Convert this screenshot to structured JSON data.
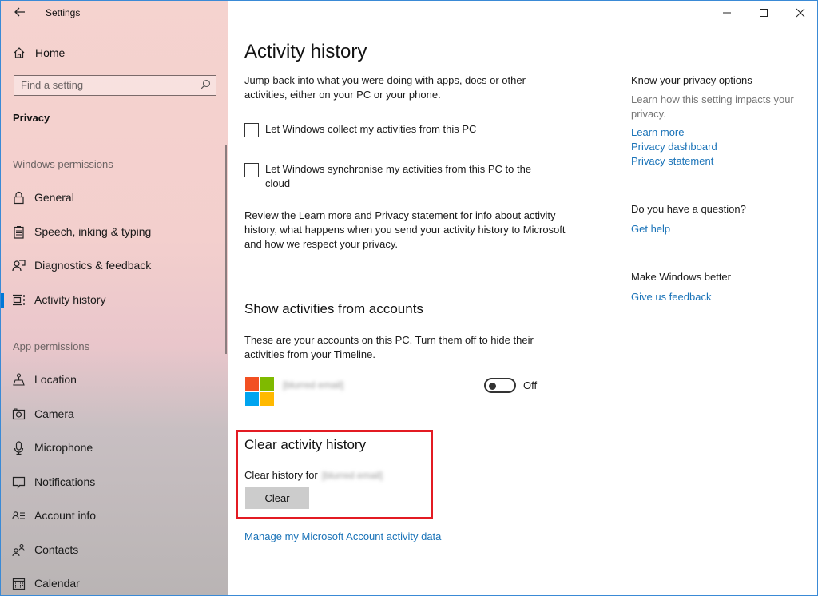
{
  "window": {
    "title": "Settings",
    "controls": {
      "minimize": "minimize",
      "maximize": "maximize",
      "close": "close"
    }
  },
  "sidebar": {
    "home_label": "Home",
    "search_placeholder": "Find a setting",
    "category": "Privacy",
    "sections": [
      {
        "header": "Windows permissions",
        "items": [
          {
            "label": "General",
            "icon": "lock-icon"
          },
          {
            "label": "Speech, inking & typing",
            "icon": "clipboard-icon"
          },
          {
            "label": "Diagnostics & feedback",
            "icon": "diagnostics-icon"
          },
          {
            "label": "Activity history",
            "icon": "timeline-icon",
            "active": true
          }
        ]
      },
      {
        "header": "App permissions",
        "items": [
          {
            "label": "Location",
            "icon": "location-icon"
          },
          {
            "label": "Camera",
            "icon": "camera-icon"
          },
          {
            "label": "Microphone",
            "icon": "microphone-icon"
          },
          {
            "label": "Notifications",
            "icon": "notification-icon"
          },
          {
            "label": "Account info",
            "icon": "account-info-icon"
          },
          {
            "label": "Contacts",
            "icon": "contacts-icon"
          },
          {
            "label": "Calendar",
            "icon": "calendar-icon"
          }
        ]
      }
    ]
  },
  "main": {
    "title": "Activity history",
    "intro": "Jump back into what you were doing with apps, docs or other activities, either on your PC or your phone.",
    "checkboxes": [
      {
        "label": "Let Windows collect my activities from this PC",
        "checked": false
      },
      {
        "label": "Let Windows synchronise my activities from this PC to the cloud",
        "checked": false
      }
    ],
    "review_text": "Review the Learn more and Privacy statement for info about activity history, what happens when you send your activity history to Microsoft and how we respect your privacy.",
    "accounts": {
      "heading": "Show activities from accounts",
      "description": "These are your accounts on this PC. Turn them off to hide their activities from your Timeline.",
      "account_email": "[blurred email]",
      "toggle_state": "Off"
    },
    "clear": {
      "heading": "Clear activity history",
      "label": "Clear history for",
      "account_email": "[blurred email]",
      "button": "Clear"
    },
    "manage_link": "Manage my Microsoft Account activity data"
  },
  "aside": {
    "privacy_heading": "Know your privacy options",
    "privacy_desc": "Learn how this setting impacts your privacy.",
    "links": [
      "Learn more",
      "Privacy dashboard",
      "Privacy statement"
    ],
    "question_heading": "Do you have a question?",
    "help_link": "Get help",
    "better_heading": "Make Windows better",
    "feedback_link": "Give us feedback"
  },
  "colors": {
    "accent": "#0078d7",
    "link": "#1a73b8",
    "highlight": "#e31b23",
    "ms_red": "#f25022",
    "ms_green": "#7fba00",
    "ms_blue": "#00a4ef",
    "ms_yellow": "#ffb900"
  }
}
